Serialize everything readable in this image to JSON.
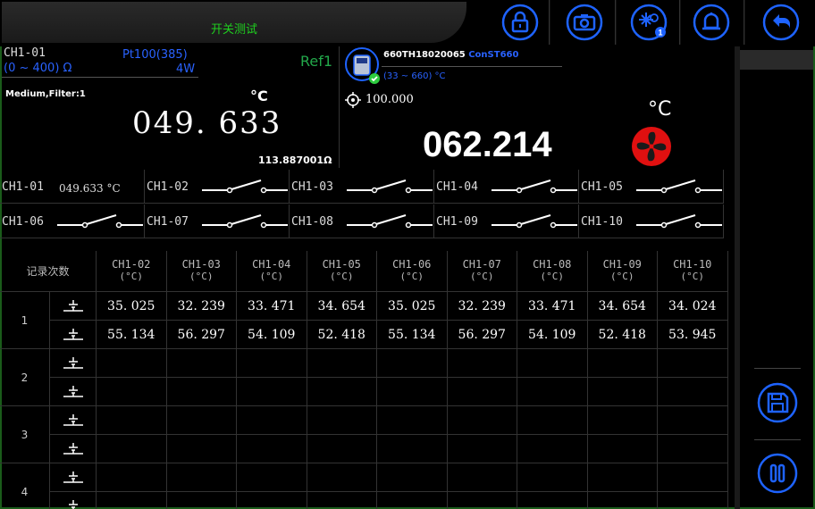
{
  "header": {
    "title": "开关测试",
    "buttons": [
      "lock-icon",
      "camera-icon",
      "snowflake-sun-icon",
      "bell-icon",
      "back-arrow-icon"
    ],
    "snowflake_badge": "1"
  },
  "channel": {
    "id": "CH1-01",
    "sensor": "Pt100(385)",
    "range": "(0 ~ 400) Ω",
    "power": "4W",
    "ref_label": "Ref1",
    "filter": "Medium,Filter:1",
    "unit": "°C",
    "value": "049. 633",
    "resistance": "113.887001Ω"
  },
  "reference": {
    "model": "660TH18020065",
    "brand": "ConST660",
    "range": "(33 ~ 660) °C",
    "target": "100.000",
    "unit": "°C",
    "value": "062.214"
  },
  "channels": [
    {
      "id": "CH1-01",
      "value": "049.633 °C"
    },
    {
      "id": "CH1-02"
    },
    {
      "id": "CH1-03"
    },
    {
      "id": "CH1-04"
    },
    {
      "id": "CH1-05"
    },
    {
      "id": "CH1-06"
    },
    {
      "id": "CH1-07"
    },
    {
      "id": "CH1-08"
    },
    {
      "id": "CH1-09"
    },
    {
      "id": "CH1-10"
    }
  ],
  "table": {
    "first_header": "记录次数",
    "unit": "(°C)",
    "columns": [
      "CH1-02",
      "CH1-03",
      "CH1-04",
      "CH1-05",
      "CH1-06",
      "CH1-07",
      "CH1-08",
      "CH1-09",
      "CH1-10"
    ],
    "records": [
      {
        "index": "1",
        "rows": [
          [
            "35. 025",
            "32. 239",
            "33. 471",
            "34. 654",
            "35. 025",
            "32. 239",
            "33. 471",
            "34. 654",
            "34. 024"
          ],
          [
            "55. 134",
            "56. 297",
            "54. 109",
            "52. 418",
            "55. 134",
            "56. 297",
            "54. 109",
            "52. 418",
            "53. 945"
          ]
        ]
      },
      {
        "index": "2",
        "rows": [
          [],
          []
        ]
      },
      {
        "index": "3",
        "rows": [
          [],
          []
        ]
      },
      {
        "index": "4",
        "rows": [
          [],
          []
        ]
      }
    ]
  },
  "side_buttons": [
    "save-icon",
    "pause-icon"
  ]
}
